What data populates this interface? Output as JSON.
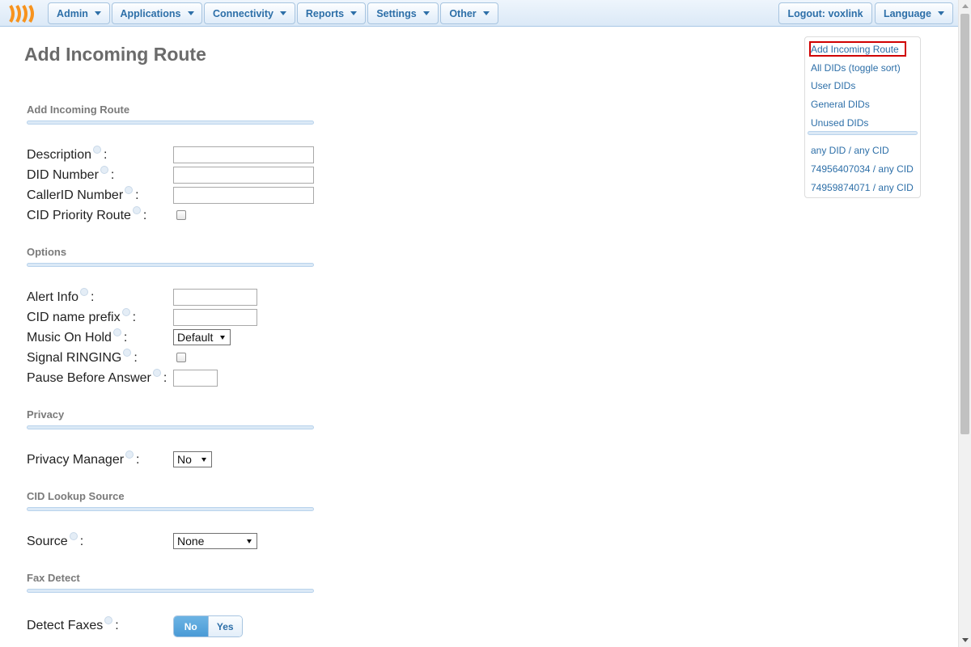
{
  "nav": {
    "admin": "Admin",
    "applications": "Applications",
    "connectivity": "Connectivity",
    "reports": "Reports",
    "settings": "Settings",
    "other": "Other",
    "logout": "Logout: voxlink",
    "language": "Language"
  },
  "page": {
    "title": "Add Incoming Route"
  },
  "sections": {
    "route": "Add Incoming Route",
    "options": "Options",
    "privacy": "Privacy",
    "cid_lookup": "CID Lookup Source",
    "fax": "Fax Detect"
  },
  "fields": {
    "description": {
      "label": "Description",
      "value": ""
    },
    "did_number": {
      "label": "DID Number",
      "value": ""
    },
    "callerid_number": {
      "label": "CallerID Number",
      "value": ""
    },
    "cid_priority": {
      "label": "CID Priority Route"
    },
    "alert_info": {
      "label": "Alert Info",
      "value": ""
    },
    "cid_name_prefix": {
      "label": "CID name prefix",
      "value": ""
    },
    "music_on_hold": {
      "label": "Music On Hold",
      "selected": "Default"
    },
    "signal_ringing": {
      "label": "Signal RINGING"
    },
    "pause_before_answer": {
      "label": "Pause Before Answer",
      "value": ""
    },
    "privacy_manager": {
      "label": "Privacy Manager",
      "selected": "No"
    },
    "source": {
      "label": "Source",
      "selected": "None"
    },
    "detect_faxes": {
      "label": "Detect Faxes",
      "option_no": "No",
      "option_yes": "Yes",
      "selected": "No"
    }
  },
  "colon": ":",
  "rnav": {
    "add_route": "Add Incoming Route",
    "all_dids": "All DIDs (toggle sort)",
    "user_dids": "User DIDs",
    "general_dids": "General DIDs",
    "unused_dids": "Unused DIDs",
    "routes": [
      "any DID / any CID",
      "74956407034 / any CID",
      "74959874071 / any CID"
    ]
  },
  "colors": {
    "accent": "#2d6fa8",
    "toggle_on": "#4a9ad6",
    "active_border": "#d00000"
  }
}
